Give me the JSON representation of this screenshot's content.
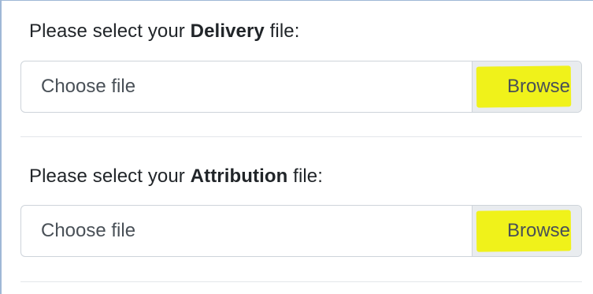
{
  "sections": [
    {
      "label_prefix": "Please select your ",
      "label_bold": "Delivery",
      "label_suffix": " file:",
      "placeholder": "Choose file",
      "button_label": "Browse"
    },
    {
      "label_prefix": "Please select your ",
      "label_bold": "Attribution",
      "label_suffix": " file:",
      "placeholder": "Choose file",
      "button_label": "Browse"
    }
  ],
  "colors": {
    "highlight": "#f0f21a",
    "button_bg": "#e9ecef",
    "border": "#ced4da",
    "text": "#212529"
  }
}
